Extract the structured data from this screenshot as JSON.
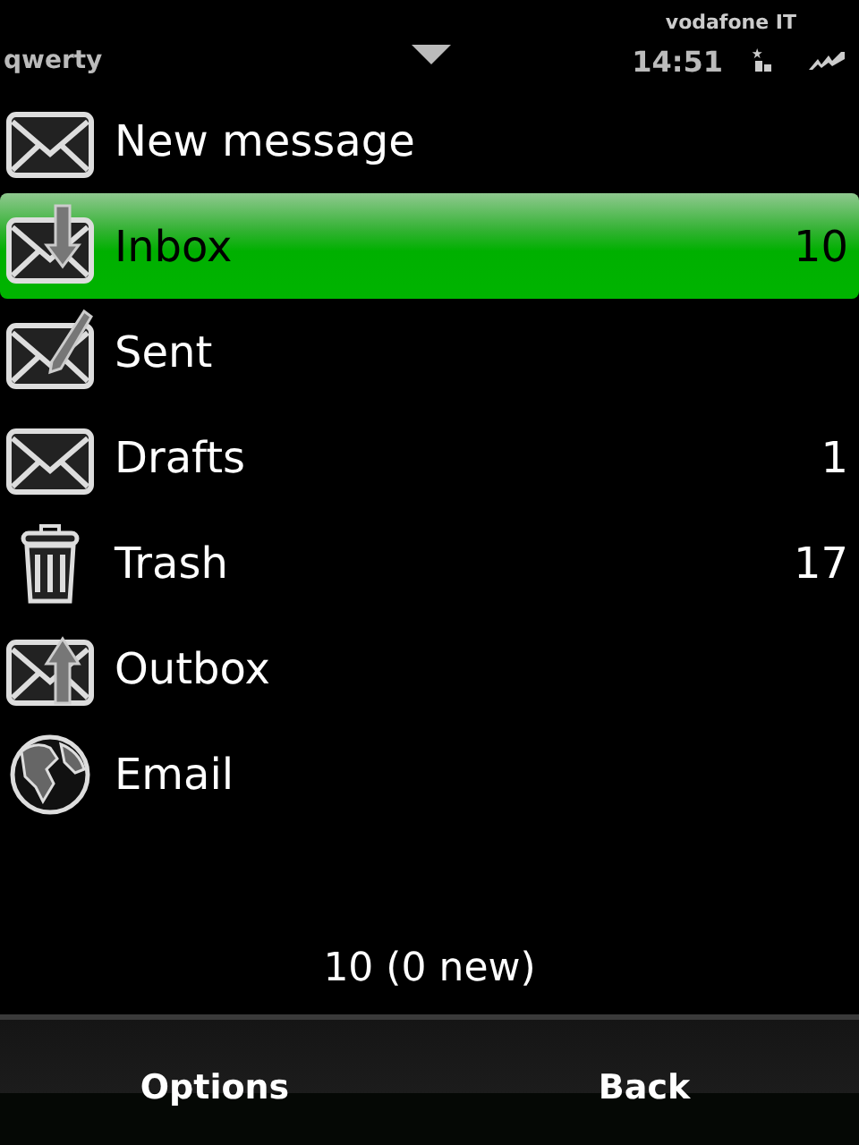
{
  "status_bar": {
    "operator": "vodafone IT",
    "input_mode": "qwerty",
    "time": "14:51"
  },
  "folders": [
    {
      "label": "New message",
      "kind": "envelope",
      "selected": false
    },
    {
      "label": "Inbox",
      "kind": "inbox",
      "count": "10",
      "selected": true
    },
    {
      "label": "Sent",
      "kind": "sent",
      "selected": false
    },
    {
      "label": "Drafts",
      "kind": "envelope",
      "count": "1",
      "selected": false
    },
    {
      "label": "Trash",
      "kind": "trash",
      "count": "17",
      "selected": false
    },
    {
      "label": "Outbox",
      "kind": "outbox",
      "selected": false
    },
    {
      "label": "Email",
      "kind": "globe",
      "selected": false
    }
  ],
  "summary": "10 (0 new)",
  "softkeys": [
    "Options",
    "Back"
  ]
}
